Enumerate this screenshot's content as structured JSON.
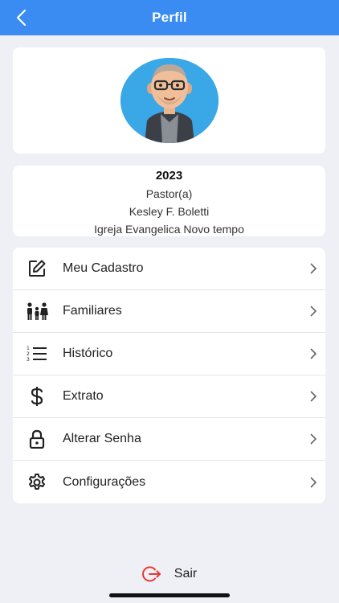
{
  "header": {
    "title": "Perfil",
    "back_icon": "chevron-left-icon"
  },
  "profile": {
    "year": "2023",
    "role": "Pastor(a)",
    "name": "Kesley F. Boletti",
    "church": "Igreja Evangelica Novo tempo"
  },
  "menu": {
    "items": [
      {
        "label": "Meu Cadastro",
        "icon": "edit-icon"
      },
      {
        "label": "Familiares",
        "icon": "family-icon"
      },
      {
        "label": "Histórico",
        "icon": "numbered-list-icon"
      },
      {
        "label": "Extrato",
        "icon": "dollar-icon"
      },
      {
        "label": "Alterar Senha",
        "icon": "lock-icon"
      },
      {
        "label": "Configurações",
        "icon": "gear-icon"
      }
    ]
  },
  "logout": {
    "label": "Sair",
    "icon": "logout-icon"
  },
  "colors": {
    "header": "#3a8cf2",
    "background": "#eef0f5",
    "logout_icon": "#e53935"
  }
}
